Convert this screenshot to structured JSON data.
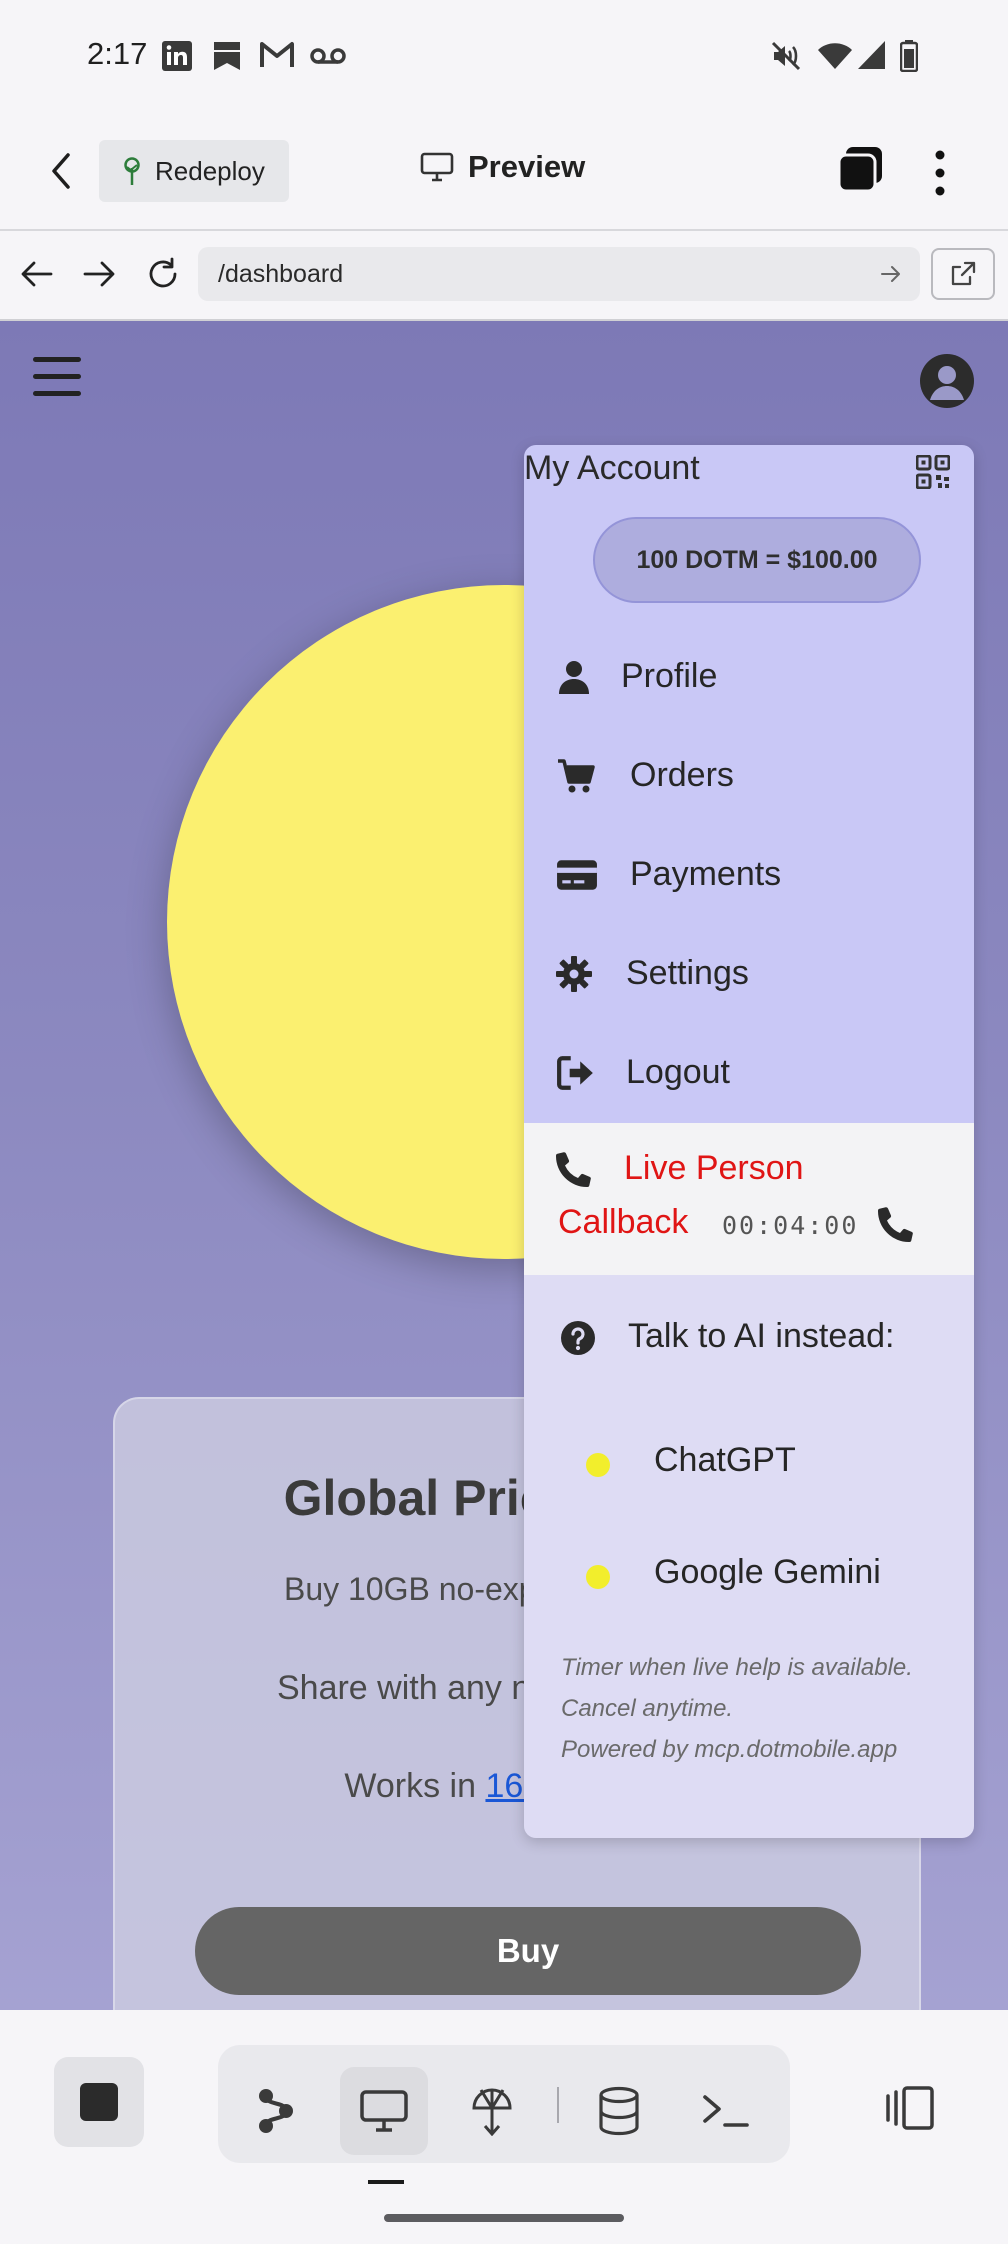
{
  "status_bar": {
    "time": "2:17",
    "left_icons": [
      "linkedin-icon",
      "bookmark-icon",
      "gmail-icon",
      "voicemail-icon"
    ],
    "right_icons": [
      "mute-icon",
      "wifi-icon",
      "signal-icon",
      "battery-icon"
    ]
  },
  "app_bar": {
    "back_icon": "chevron-left-icon",
    "redeploy_label": "Redeploy",
    "preview_label": "Preview",
    "tabs_icon": "tabs-icon",
    "more_icon": "more-vertical-icon"
  },
  "url_bar": {
    "url": "/dashboard"
  },
  "page": {
    "promo": {
      "title": "Global Priority Data",
      "line1": "Buy 10GB no-expiry data for $10",
      "line2": "Share with any number of users",
      "line3_prefix": "Works in ",
      "line3_link": "160 countries",
      "buy_label": "Buy"
    },
    "colors": {
      "sun": "#fbf070",
      "menu_top": "#c9c8f6",
      "callback_red": "#e01515",
      "link_blue": "#1a57d6"
    }
  },
  "account_menu": {
    "heading": "My Account",
    "balance": "100 DOTM = $100.00",
    "items": [
      {
        "label": "Profile",
        "icon": "user-icon"
      },
      {
        "label": "Orders",
        "icon": "cart-icon"
      },
      {
        "label": "Payments",
        "icon": "credit-card-icon"
      },
      {
        "label": "Settings",
        "icon": "gear-icon"
      },
      {
        "label": "Logout",
        "icon": "logout-icon"
      }
    ],
    "callback": {
      "label_line1": "Live Person",
      "label_line2": "Callback",
      "timer": "00:04:00"
    },
    "ai": {
      "heading": "Talk to AI instead:",
      "options": [
        "ChatGPT",
        "Google Gemini"
      ],
      "note_line1": "Timer when live help is available.",
      "note_line2": "Cancel anytime.",
      "note_line3": "Powered by mcp.dotmobile.app"
    }
  },
  "bottom_nav": {
    "tools": [
      "stop-icon",
      "flow-icon",
      "monitor-icon",
      "deploy-icon",
      "database-icon",
      "terminal-icon",
      "split-view-icon"
    ]
  }
}
